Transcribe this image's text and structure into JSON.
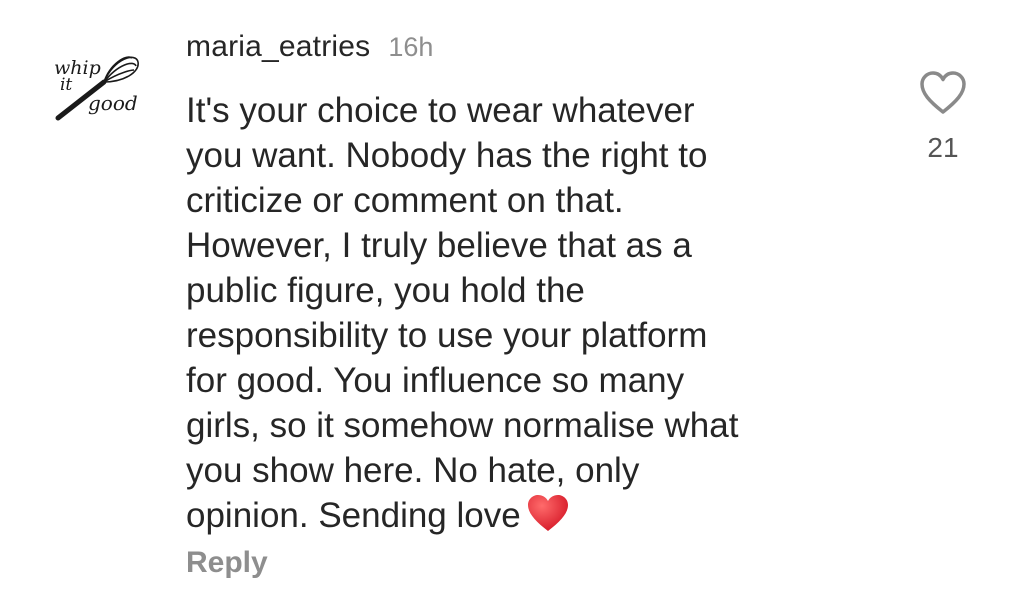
{
  "comment": {
    "avatar_text": [
      "whip",
      "it",
      "good"
    ],
    "username": "maria_eatries",
    "timestamp": "16h",
    "body": "It's your choice to wear whatever\nyou want. Nobody has the right to\ncriticize or comment on that.\nHowever, I truly believe that as a\npublic figure, you hold the\nresponsibility to use your platform\nfor good. You influence so many\ngirls, so it somehow normalise what\nyou show here. No hate, only\nopinion. Sending love",
    "body_emoji": "red-heart-emoji",
    "reply_label": "Reply",
    "like_icon": "heart-outline-icon",
    "like_count": "21"
  },
  "colors": {
    "text": "#262626",
    "muted": "#8e8e8e",
    "heart_emoji": "#e0303a"
  }
}
